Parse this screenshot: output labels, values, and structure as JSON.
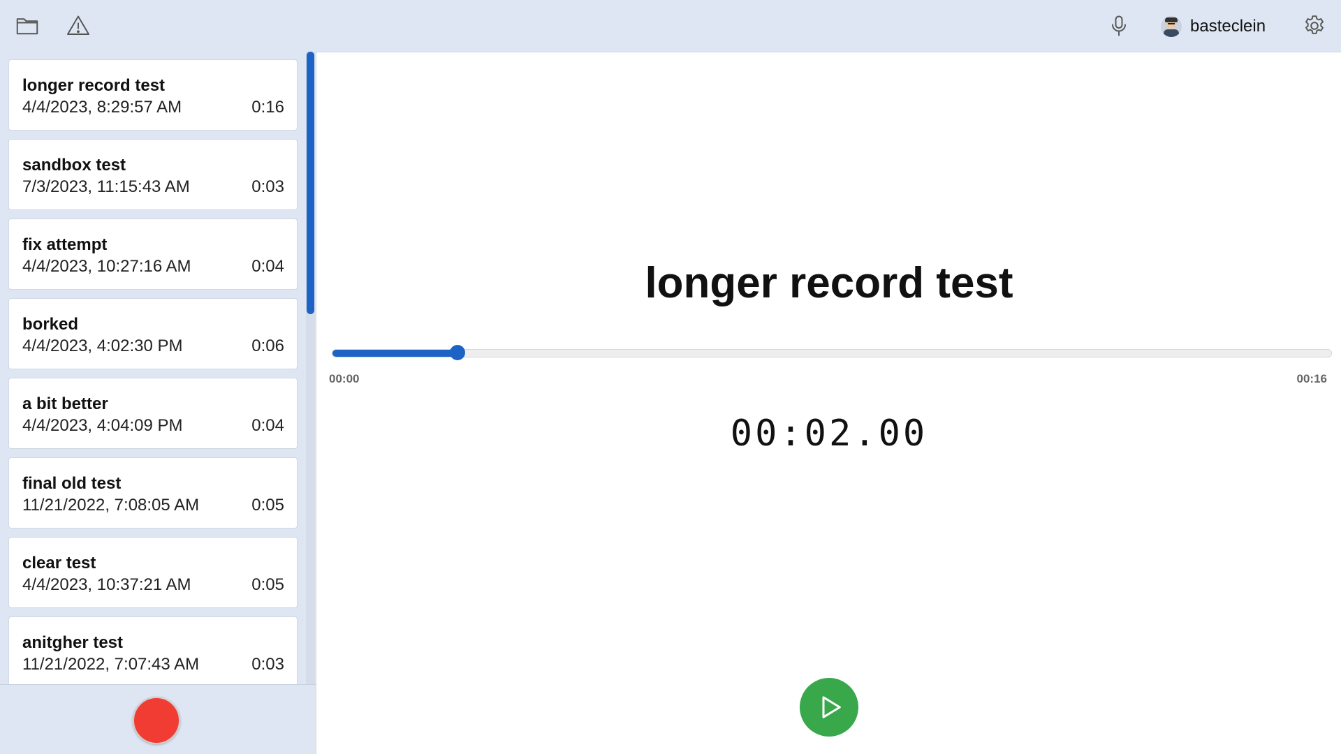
{
  "topbar": {
    "icons": {
      "folder": "folder-icon",
      "warning": "warning-icon",
      "microphone": "microphone-icon",
      "settings": "gear-icon"
    },
    "username": "basteclein"
  },
  "recordings": [
    {
      "title": "longer record test",
      "date": "4/4/2023, 8:29:57 AM",
      "duration": "0:16"
    },
    {
      "title": "sandbox test",
      "date": "7/3/2023, 11:15:43 AM",
      "duration": "0:03"
    },
    {
      "title": "fix attempt",
      "date": "4/4/2023, 10:27:16 AM",
      "duration": "0:04"
    },
    {
      "title": "borked",
      "date": "4/4/2023, 4:02:30 PM",
      "duration": "0:06"
    },
    {
      "title": "a bit better",
      "date": "4/4/2023, 4:04:09 PM",
      "duration": "0:04"
    },
    {
      "title": "final old test",
      "date": "11/21/2022, 7:08:05 AM",
      "duration": "0:05"
    },
    {
      "title": "clear test",
      "date": "4/4/2023, 10:37:21 AM",
      "duration": "0:05"
    },
    {
      "title": "anitgher test",
      "date": "11/21/2022, 7:07:43 AM",
      "duration": "0:03"
    }
  ],
  "player": {
    "title": "longer record test",
    "start_time": "00:00",
    "end_time": "00:16",
    "current_time": "00:02.00",
    "progress_fraction": 0.125
  },
  "colors": {
    "accent": "#1d63c6",
    "record": "#f03c32",
    "play": "#38a84b",
    "chrome": "#dde6f2"
  }
}
